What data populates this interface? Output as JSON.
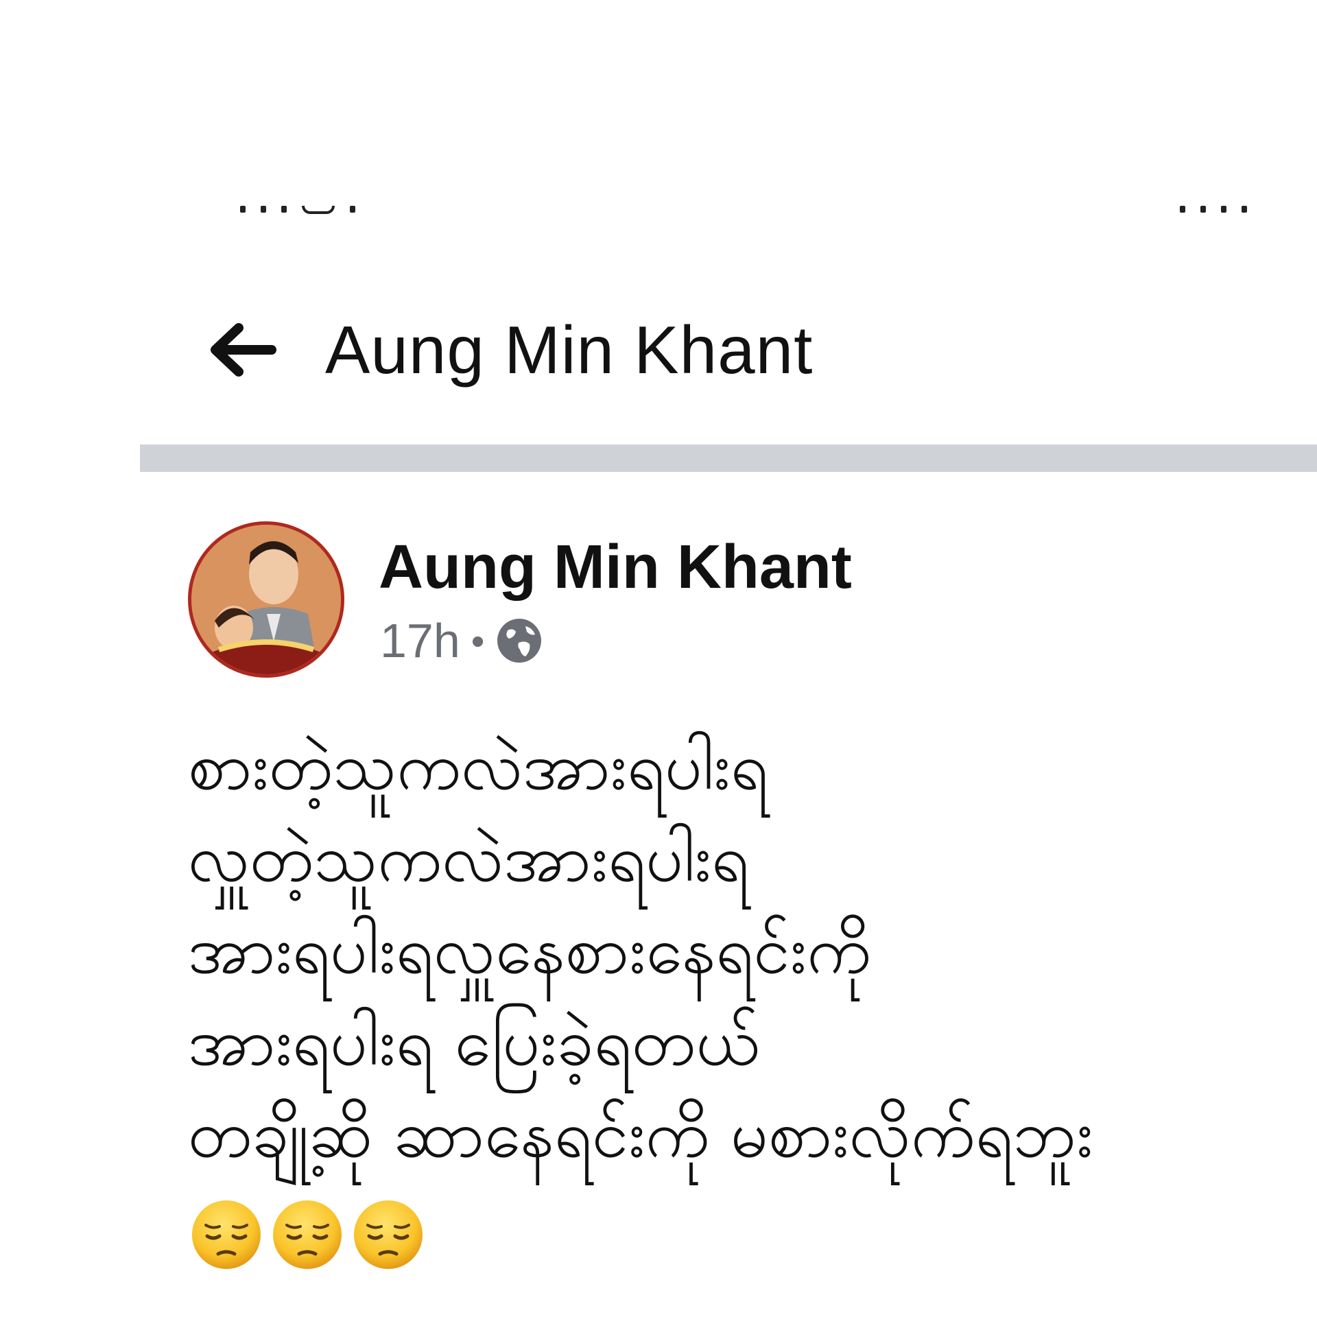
{
  "header": {
    "title": "Aung Min Khant",
    "back_icon": "arrow-left-icon"
  },
  "post": {
    "author": "Aung Min Khant",
    "time": "17h",
    "separator": "•",
    "audience_icon": "globe-icon",
    "lines": [
      "စားတဲ့သူကလဲအားရပါးရ",
      "လှူတဲ့သူကလဲအားရပါးရ",
      "အားရပါးရလှူနေစားနေရင်းကို",
      "အားရပါးရ ပြေးခဲ့ရတယ်",
      "တချို့ဆို ဆာနေရင်းကို မစားလိုက်ရဘူး"
    ],
    "emojis": [
      "pensive-face-icon",
      "pensive-face-icon",
      "pensive-face-icon"
    ]
  },
  "colors": {
    "divider": "#cfd3d8",
    "meta_text": "#6b6f75",
    "avatar_border": "#b0281e"
  }
}
